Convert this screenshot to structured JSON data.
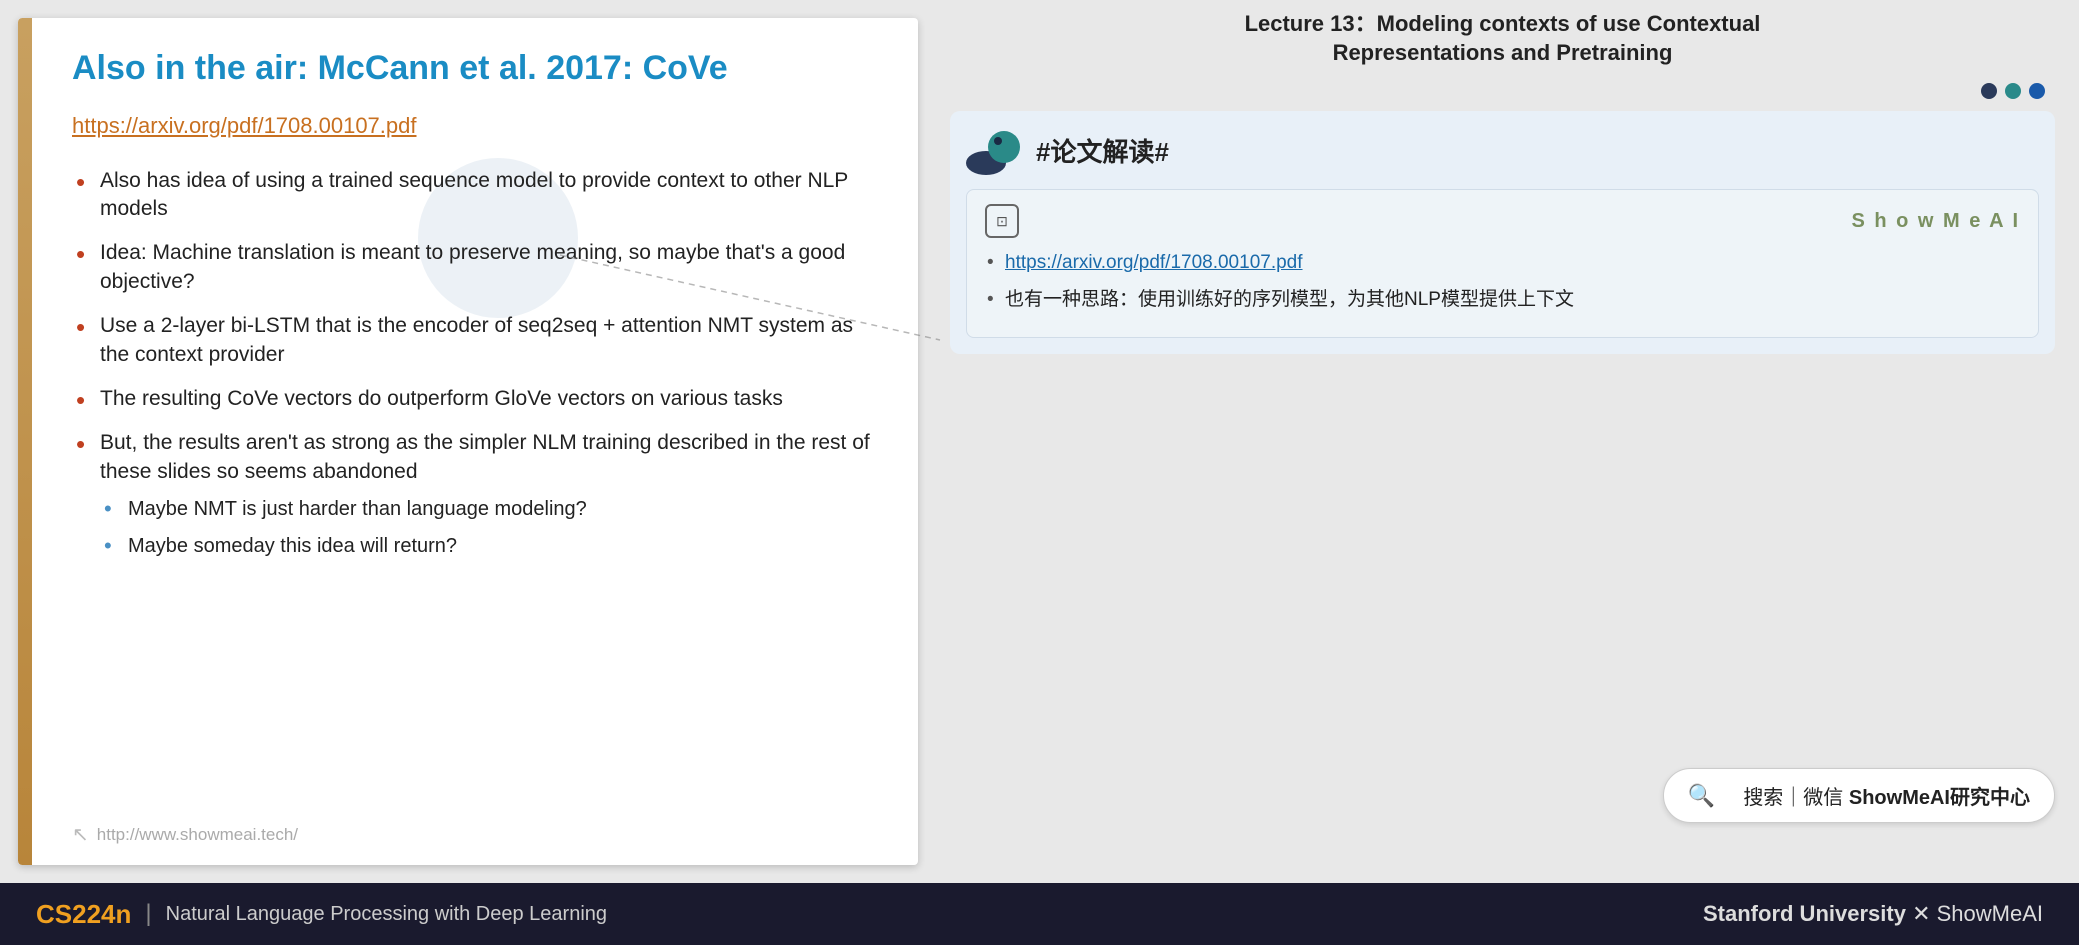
{
  "slide": {
    "title": "Also in the air: McCann et al. 2017: CoVe",
    "link": "https://arxiv.org/pdf/1708.00107.pdf",
    "bullets": [
      "Also has idea of using a trained sequence model to provide context to other NLP models",
      "Idea: Machine translation is meant to preserve meaning, so maybe that's a good objective?",
      "Use a 2-layer bi-LSTM that is the encoder of seq2seq + attention NMT system as the context provider",
      "The resulting CoVe vectors do outperform GloVe vectors on various tasks",
      "But, the results aren't as strong as the simpler NLM training described in the rest of these slides so seems abandoned"
    ],
    "sub_bullets": [
      "Maybe NMT is just harder than language modeling?",
      "Maybe someday this idea will return?"
    ],
    "footer_text": "http://www.showmeai.tech/"
  },
  "right_panel": {
    "lecture_title_line1": "Lecture 13：Modeling contexts of use Contextual",
    "lecture_title_line2": "Representations and Pretraining",
    "hashtag": "#论文解读#",
    "showmeai_label": "S h o w M e A I",
    "card_link": "https://arxiv.org/pdf/1708.00107.pdf",
    "card_bullet": "也有一种思路：使用训练好的序列模型，为其他NLP模型提供上下文"
  },
  "search_bar": {
    "icon": "🔍",
    "text": "搜索 | 微信 ShowMeAI研究中心"
  },
  "bottom_bar": {
    "course_code": "CS224n",
    "divider": "|",
    "subtitle": "Natural Language Processing with Deep Learning",
    "right_text": "Stanford University",
    "right_suffix": "✕ ShowMeAI"
  }
}
